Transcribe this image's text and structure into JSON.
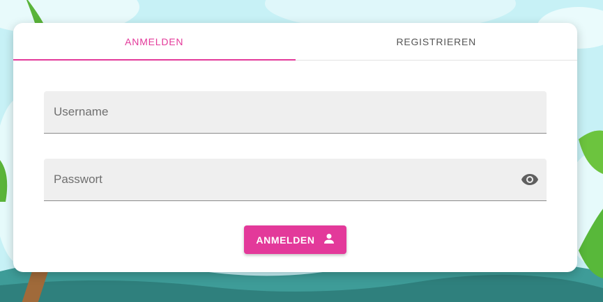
{
  "tabs": {
    "login_label": "ANMELDEN",
    "register_label": "REGISTRIEREN",
    "active": "login"
  },
  "form": {
    "username_placeholder": "Username",
    "username_value": "",
    "password_placeholder": "Passwort",
    "password_value": "",
    "password_toggle_icon": "eye-icon",
    "submit_label": "ANMELDEN",
    "submit_icon": "person-icon"
  },
  "colors": {
    "accent": "#e3399a",
    "card_background": "#ffffff",
    "field_background": "#efefef"
  }
}
